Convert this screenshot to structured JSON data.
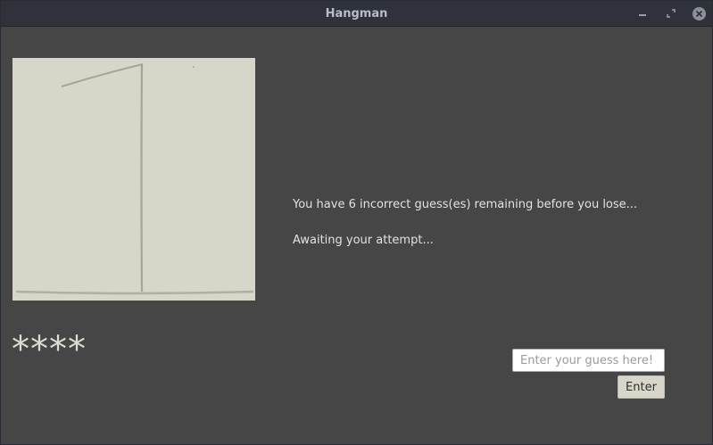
{
  "window": {
    "title": "Hangman",
    "minimize_icon": "minimize-icon",
    "maximize_icon": "maximize-icon",
    "close_icon": "close-icon"
  },
  "game": {
    "remaining_message": "You have 6 incorrect guess(es) remaining before you lose...",
    "status_message": "Awaiting your attempt...",
    "masked_word": "****",
    "incorrect_guesses_remaining": 6
  },
  "guess": {
    "placeholder": "Enter your guess here!",
    "value": "",
    "button_label": "Enter"
  },
  "colors": {
    "background": "#464646",
    "titlebar": "#2f323b",
    "paper": "#d8d5c9",
    "text": "#e2e2e2"
  }
}
